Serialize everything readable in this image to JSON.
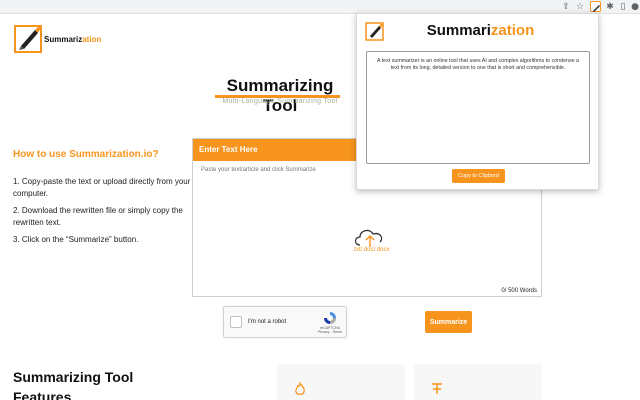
{
  "colors": {
    "accent": "#f7941d",
    "input_header_text": "#ffffff"
  },
  "browser": {
    "icons": [
      "share-icon",
      "star-icon",
      "extension-summarization-icon",
      "puzzle-icon",
      "sidebar-icon",
      "profile-icon"
    ]
  },
  "site": {
    "name_part1": "Summariz",
    "name_part2": "ation"
  },
  "hero": {
    "title": "Summarizing Tool",
    "subtitle": "Multi-Language Summarizing Tool"
  },
  "howto": {
    "title": "How to use Summarization.io?",
    "steps": [
      "1. Copy-paste the text or upload directly from your computer.",
      "2. Download the rewritten file or simply copy the rewritten text.",
      "3. Click on the “Summarize” button."
    ]
  },
  "input": {
    "header": "Enter Text Here",
    "placeholder": "Paste your text/article and click Summarize",
    "upload_label": ".txt/.doc/.docx",
    "word_count": "0/ 500 Words"
  },
  "captcha": {
    "label": "I'm not a robot",
    "brand": "reCAPTCHA",
    "links": "Privacy - Terms"
  },
  "summarize_button": "Summarize",
  "features": {
    "title": "Summarizing Tool Features"
  },
  "popup": {
    "title_part1": "Summari",
    "title_part2": "zation",
    "output_text": "A text summarizer is an online tool that uses AI and complex algorithms to condense a text from its long, detailed version to one that is short and comprehensible.",
    "copy_button": "Copy to Clipbord"
  }
}
